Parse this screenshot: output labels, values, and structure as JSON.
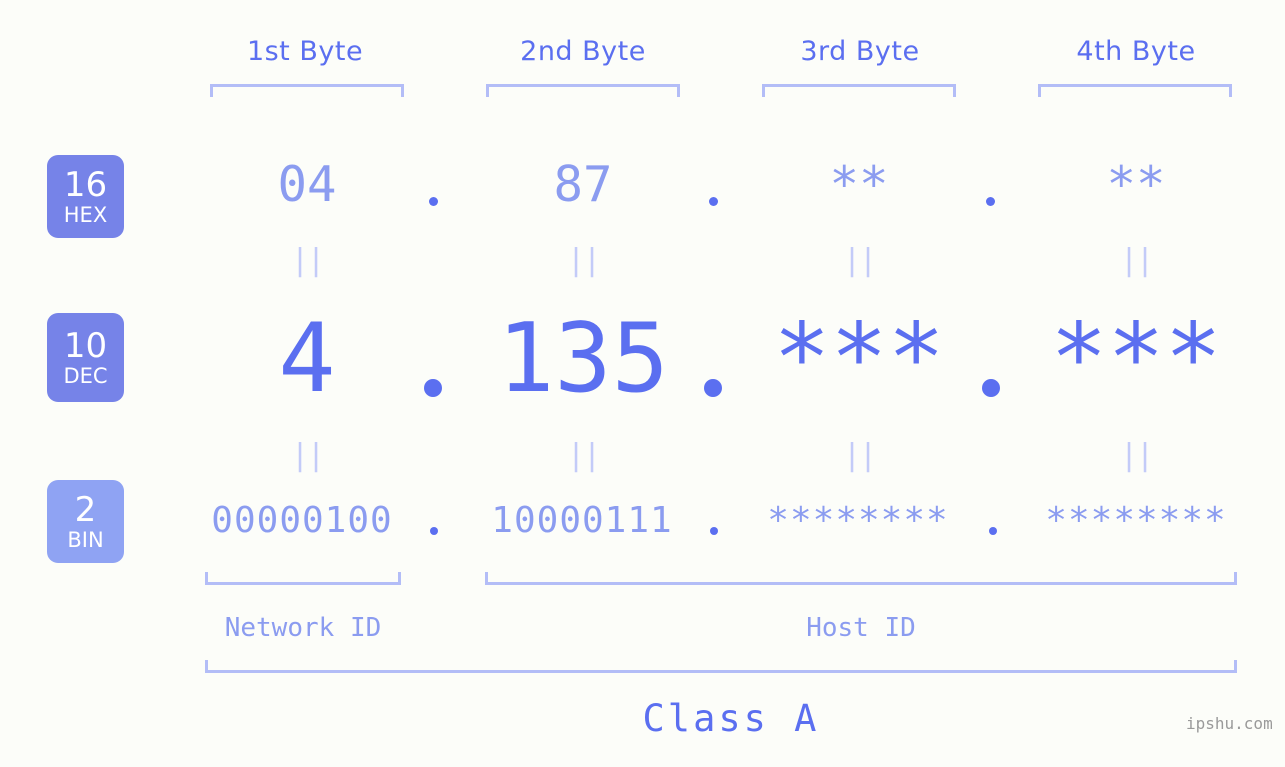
{
  "meta": {
    "background_color": "#fcfdf9",
    "accent_color": "#5b6ff0",
    "light_accent_color": "#8b9cf0",
    "bracket_color": "#b3bdf7",
    "badge_color": "#7683e8",
    "badge_color_light": "#8fa3f3"
  },
  "byte_headers": [
    {
      "label": "1st Byte"
    },
    {
      "label": "2nd Byte"
    },
    {
      "label": "3rd Byte"
    },
    {
      "label": "4th Byte"
    }
  ],
  "rows": {
    "hex": {
      "badge_number": "16",
      "badge_name": "HEX",
      "bytes": [
        "04",
        "87",
        "**",
        "**"
      ],
      "separator": "."
    },
    "dec": {
      "badge_number": "10",
      "badge_name": "DEC",
      "bytes": [
        "4",
        "135",
        "***",
        "***"
      ],
      "separator": "."
    },
    "bin": {
      "badge_number": "2",
      "badge_name": "BIN",
      "bytes": [
        "00000100",
        "10000111",
        "********",
        "********"
      ],
      "separator": "."
    }
  },
  "equals_separators": [
    "||",
    "||",
    "||",
    "||",
    "||",
    "||",
    "||",
    "||"
  ],
  "regions": [
    {
      "label": "Network ID"
    },
    {
      "label": "Host ID"
    }
  ],
  "class_label": "Class A",
  "watermark": "ipshu.com"
}
